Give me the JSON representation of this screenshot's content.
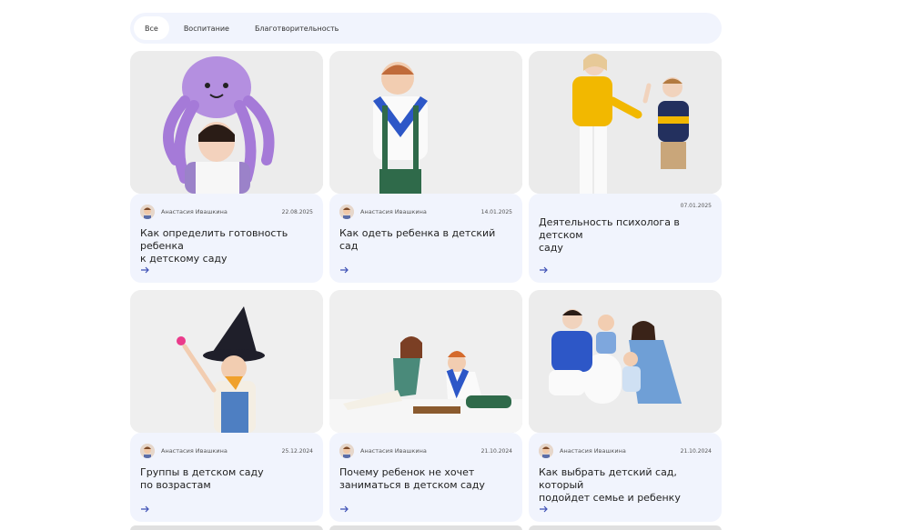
{
  "filters": [
    {
      "label": "Все",
      "active": true
    },
    {
      "label": "Воспитание",
      "active": false
    },
    {
      "label": "Благотворительность",
      "active": false
    }
  ],
  "cards": [
    {
      "author": "Анастасия Ивашкина",
      "date": "22.08.2025",
      "title": "Как определить готовность ребенка\nк детскому саду",
      "image": "child-octopus-hat"
    },
    {
      "author": "Анастасия Ивашкина",
      "date": "14.01.2025",
      "title": "Как одеть ребенка в детский сад",
      "image": "boy-scarf"
    },
    {
      "author": "",
      "date": "07.01.2025",
      "title": "Деятельность психолога в детском\nсаду",
      "image": "woman-boy-highfive"
    },
    {
      "author": "Анастасия Ивашкина",
      "date": "25.12.2024",
      "title": "Группы в детском саду\nпо возрастам",
      "image": "child-wizard-hat"
    },
    {
      "author": "Анастасия Ивашкина",
      "date": "21.10.2024",
      "title": "Почему ребенок не хочет\nзаниматься в детском саду",
      "image": "mother-child-chess"
    },
    {
      "author": "Анастасия Ивашкина",
      "date": "21.10.2024",
      "title": "Как выбрать детский сад, который\nподойдет семье и ребенку",
      "image": "family-portrait"
    }
  ],
  "colors": {
    "accent": "#3f51b5",
    "card_bg": "#f1f4fd",
    "filter_bg": "#f1f4fd"
  },
  "icons": {
    "read_more": "arrow-right-icon",
    "author": "avatar"
  }
}
